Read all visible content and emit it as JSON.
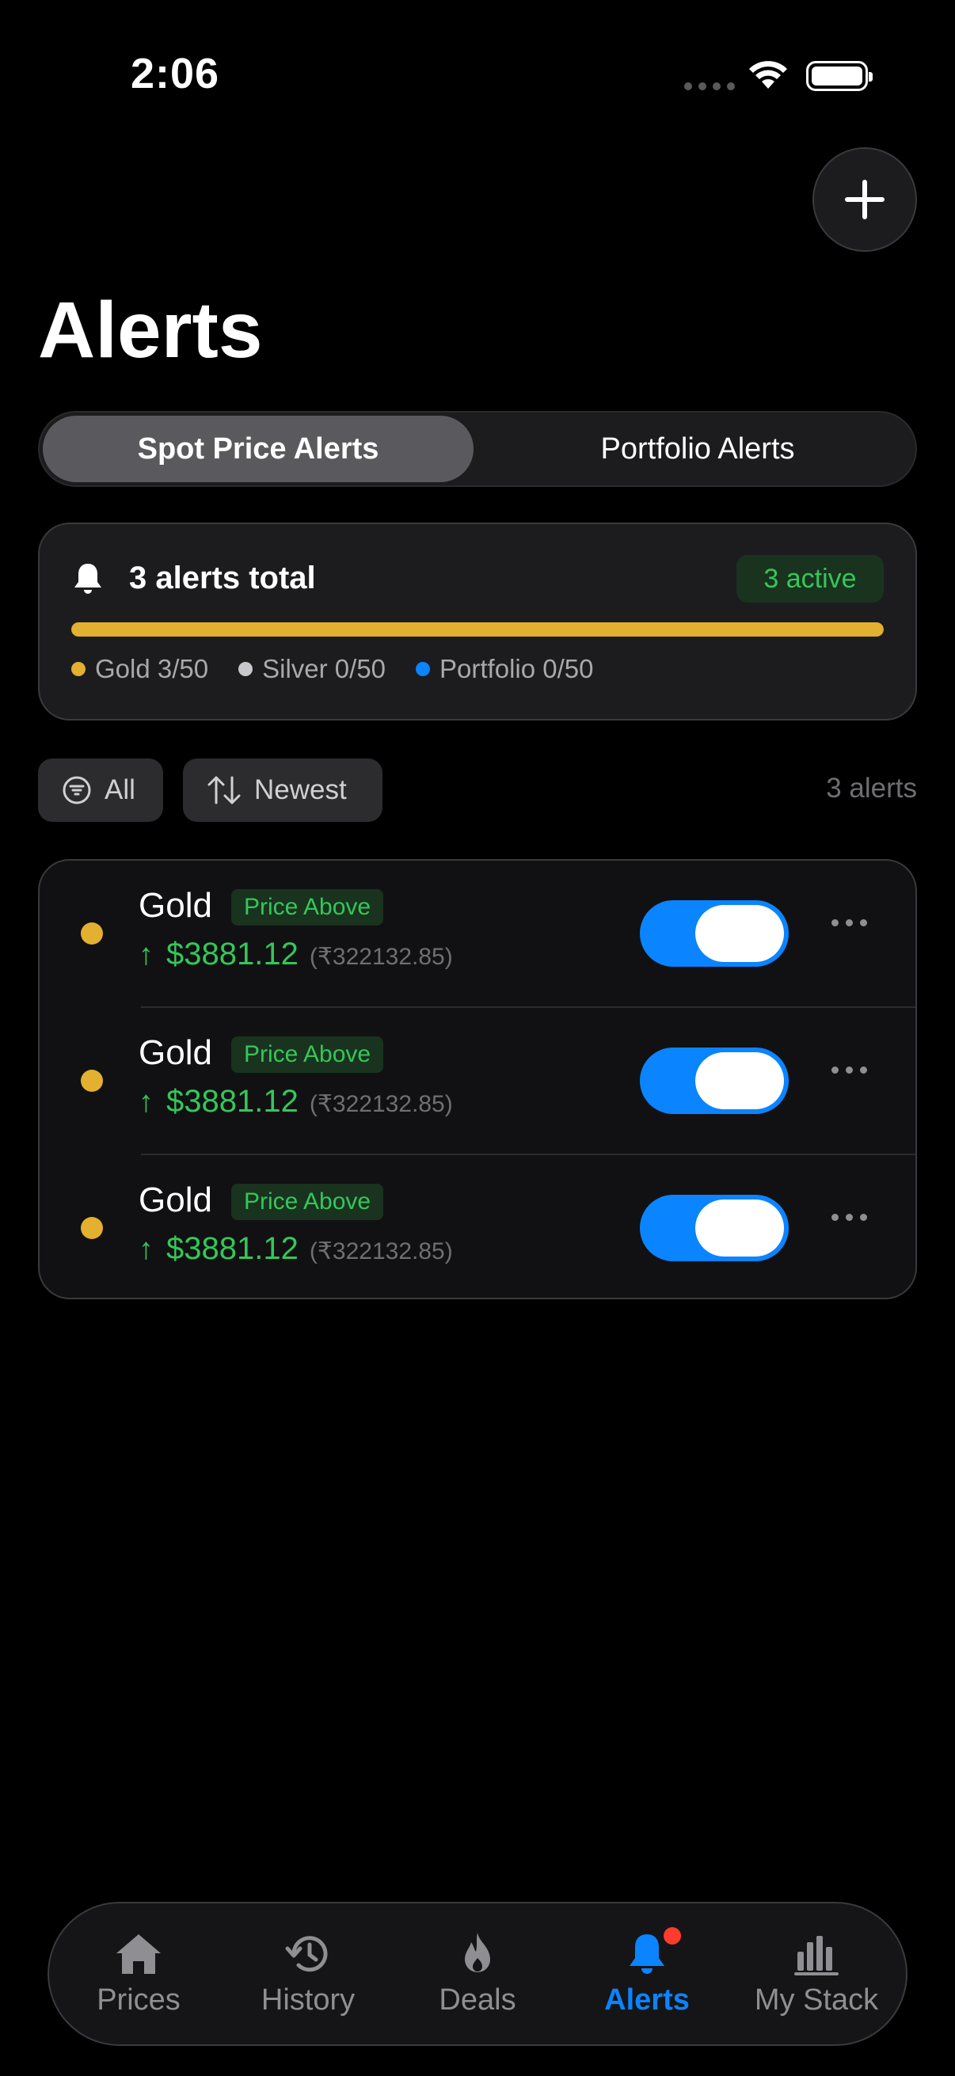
{
  "status": {
    "time": "2:06"
  },
  "header": {
    "title": "Alerts"
  },
  "segments": {
    "active": "Spot Price Alerts",
    "inactive": "Portfolio Alerts"
  },
  "summary": {
    "title": "3 alerts total",
    "active_badge": "3 active",
    "progress_fraction": 1.0,
    "legend": [
      {
        "label": "Gold 3/50",
        "color": "#e3b02f"
      },
      {
        "label": "Silver 0/50",
        "color": "#c7c7cc"
      },
      {
        "label": "Portfolio 0/50",
        "color": "#0a84ff"
      }
    ]
  },
  "filters": {
    "all_label": "All",
    "sort_label": "Newest",
    "count": "3 alerts"
  },
  "alerts": [
    {
      "metal": "Gold",
      "type": "Price Above",
      "price": "$3881.12",
      "inr": "(₹322132.85)",
      "enabled": true
    },
    {
      "metal": "Gold",
      "type": "Price Above",
      "price": "$3881.12",
      "inr": "(₹322132.85)",
      "enabled": true
    },
    {
      "metal": "Gold",
      "type": "Price Above",
      "price": "$3881.12",
      "inr": "(₹322132.85)",
      "enabled": true
    }
  ],
  "tabs": [
    {
      "label": "Prices",
      "icon": "house-icon"
    },
    {
      "label": "History",
      "icon": "history-icon"
    },
    {
      "label": "Deals",
      "icon": "flame-icon"
    },
    {
      "label": "Alerts",
      "icon": "bell-icon",
      "active": true
    },
    {
      "label": "My Stack",
      "icon": "bar-chart-icon"
    }
  ],
  "colors": {
    "accent": "#0a84ff",
    "gold": "#e3b02f",
    "positive": "#34c759",
    "badge": "#ff3b30"
  }
}
